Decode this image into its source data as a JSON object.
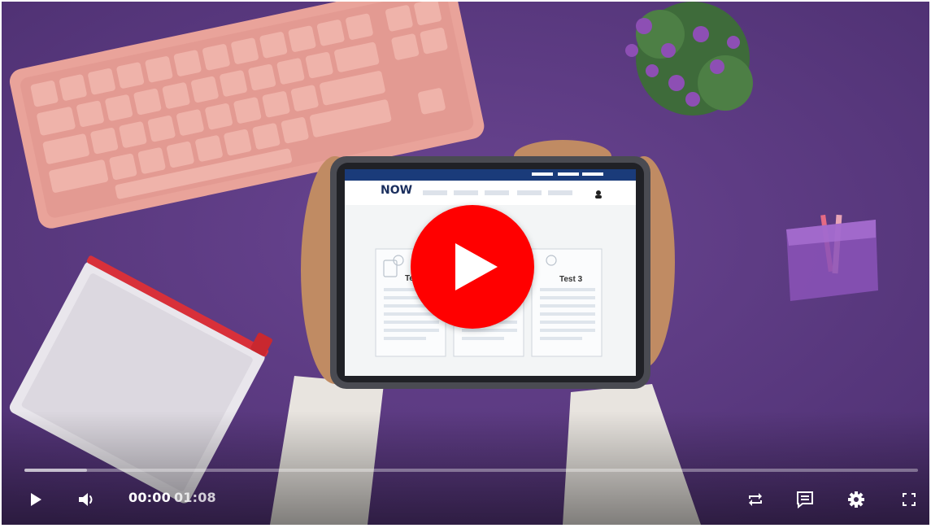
{
  "player": {
    "time": {
      "current": "00:00",
      "duration": "01:08"
    },
    "progress": {
      "played_fraction": 0.0,
      "buffered_fraction": 0.07
    }
  },
  "video_frame": {
    "brand": "NOW",
    "cards": [
      "Te",
      "",
      "Test 3"
    ]
  },
  "colors": {
    "background": "#5d3c82",
    "play_button": "#ff0000",
    "controls": "#ffffff"
  },
  "icons": {
    "play": "play-icon",
    "volume": "volume-icon",
    "loop": "loop-icon",
    "captions": "captions-icon",
    "settings": "gear-icon",
    "fullscreen": "fullscreen-icon"
  }
}
